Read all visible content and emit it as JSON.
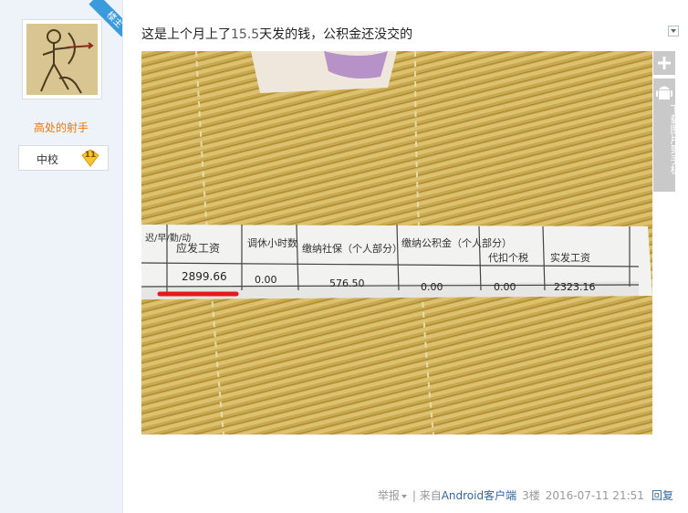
{
  "user": {
    "name": "高处的射手",
    "rank": "中校",
    "level": "11",
    "op_badge": "楼主"
  },
  "post": {
    "text_prefix": "这是上个月上了",
    "text_number": "15.5",
    "text_suffix": "天发的钱，公积金还没交的"
  },
  "photo": {
    "headers": [
      "应发工资",
      "调休小时数",
      "缴纳社保（个人部分）",
      "缴纳公积金（个人部分）",
      "代扣个税",
      "实发工资"
    ],
    "left_partial_header": "迟/早/勤/动",
    "values": [
      "2899.66",
      "0.00",
      "576.50",
      "0.00",
      "0.00",
      "2323.16"
    ]
  },
  "tools": {
    "download_label": "下载图片到手机"
  },
  "meta": {
    "report": "举报",
    "from_prefix": "来自",
    "client": "Android客户端",
    "floor": "3楼",
    "time": "2016-07-11 21:51",
    "reply": "回复"
  },
  "colors": {
    "sidebar_bg": "#eef3fa",
    "username": "#e8770e",
    "link": "#336699",
    "ribbon": "#3a9bdc",
    "underline": "#e81818"
  }
}
